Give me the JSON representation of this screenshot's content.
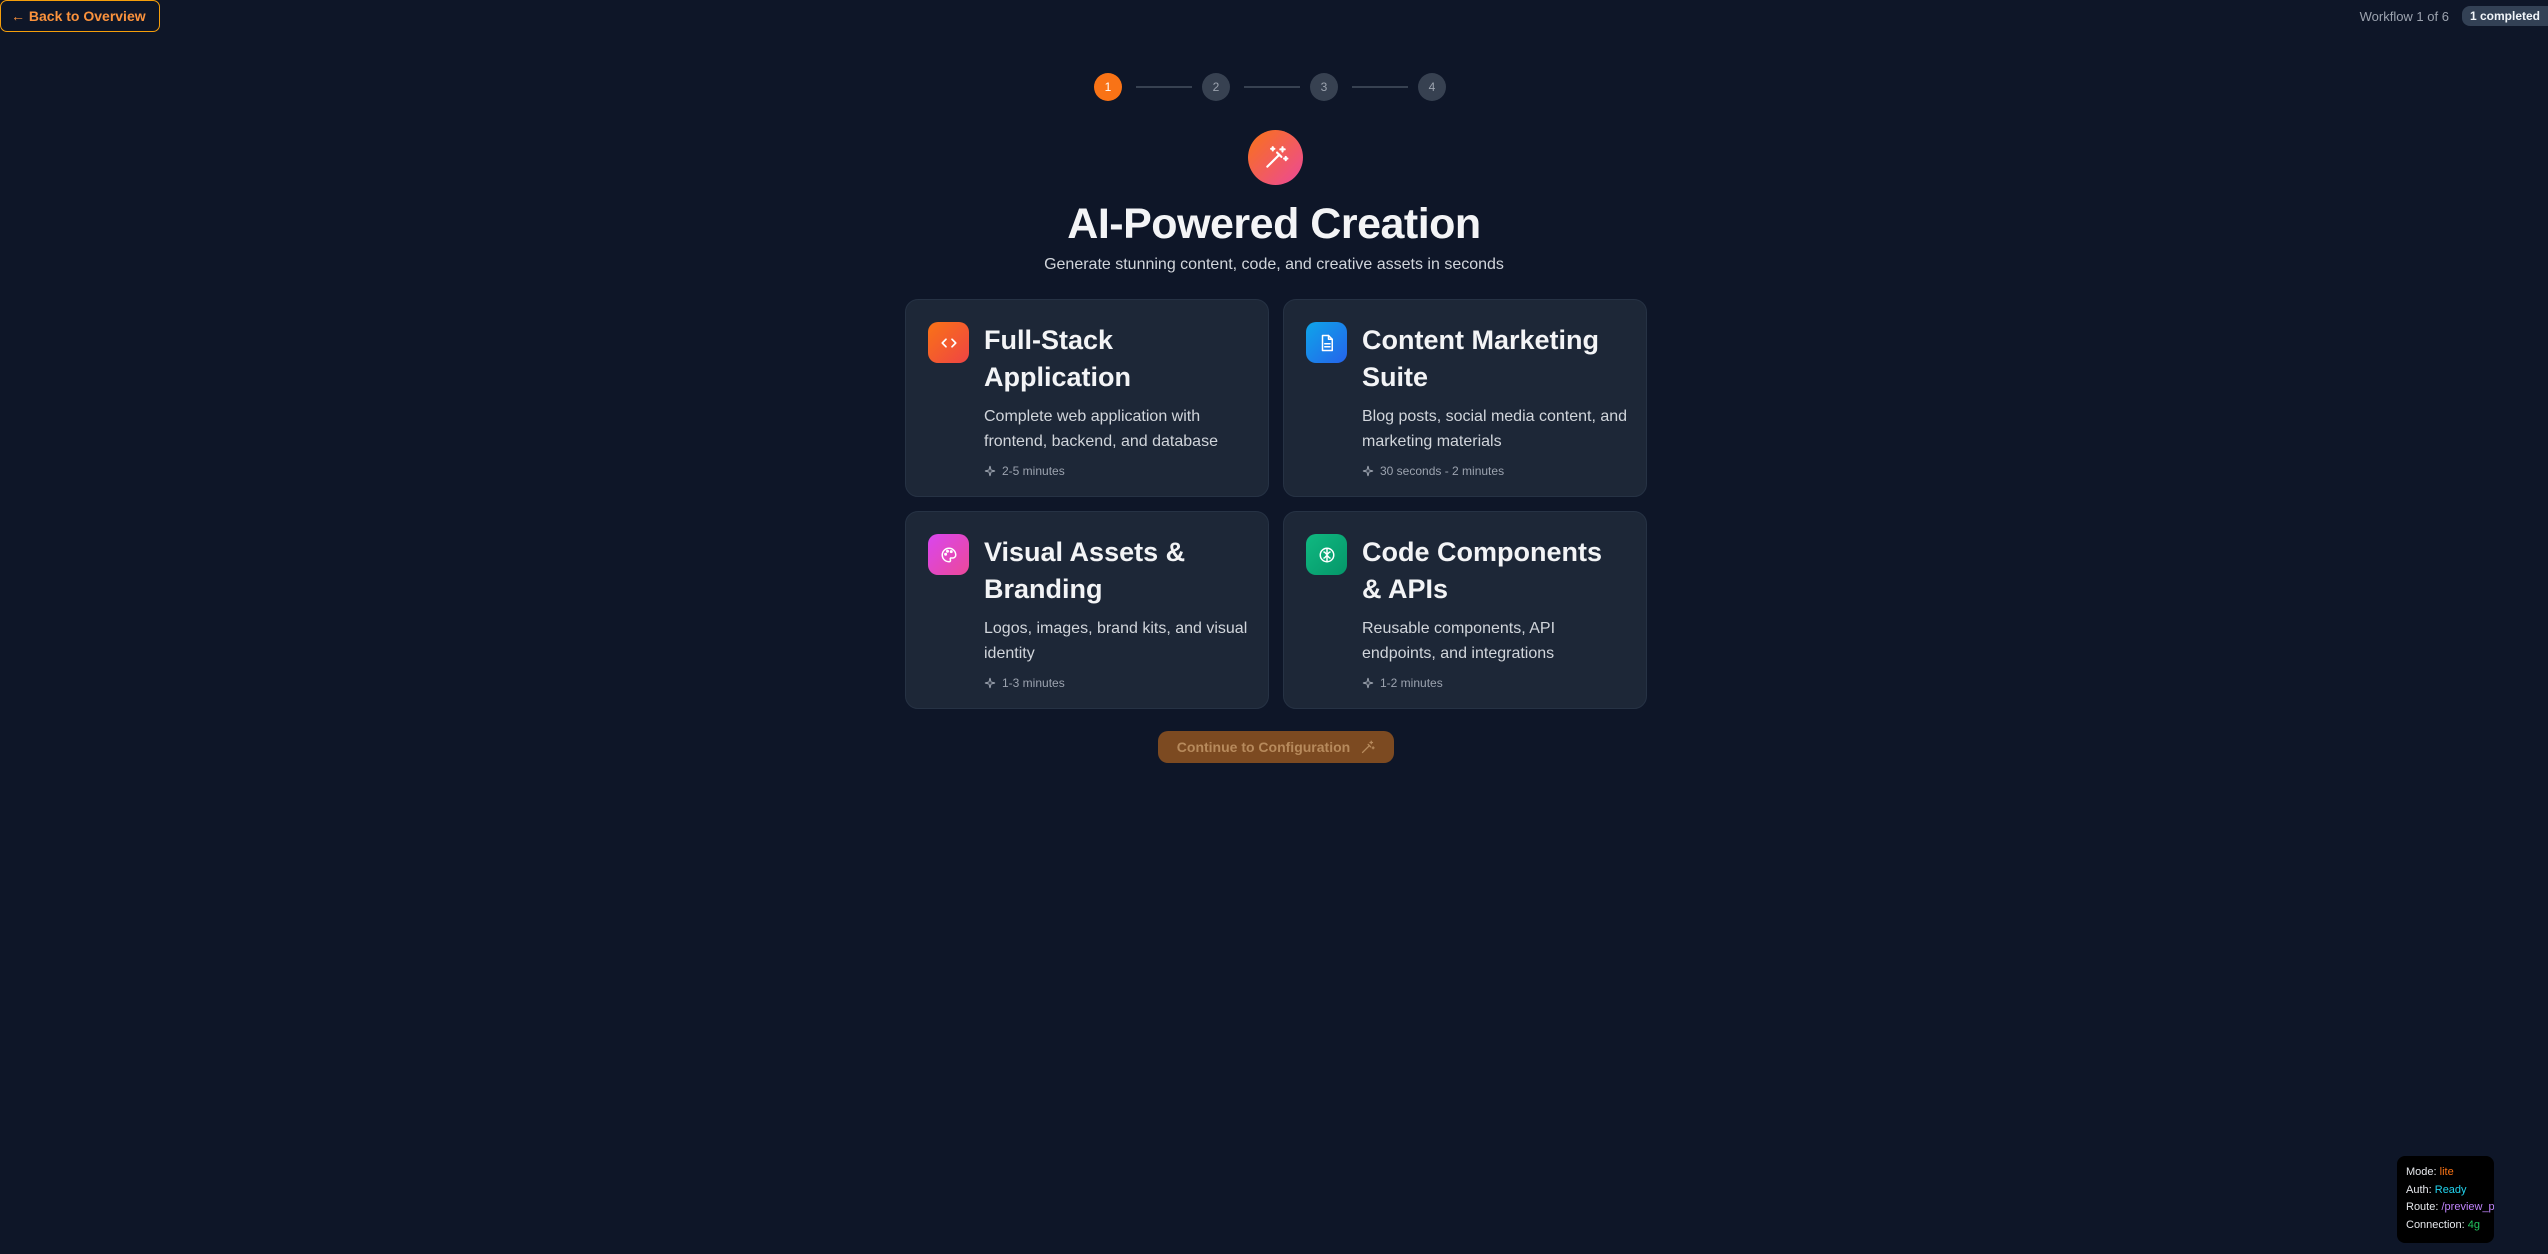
{
  "header": {
    "back_label": "← Back to Overview",
    "workflow_text": "Workflow 1 of 6",
    "completed_badge": "1 completed"
  },
  "stepper": {
    "steps": [
      "1",
      "2",
      "3",
      "4"
    ],
    "active_step": 1
  },
  "hero": {
    "icon": "magic-wand-icon",
    "title": "AI-Powered Creation",
    "subtitle": "Generate stunning content, code, and creative assets in seconds"
  },
  "cards": [
    {
      "icon": "code-icon",
      "title": "Full-Stack Application",
      "description": "Complete web application with frontend, backend, and database",
      "time": "2-5 minutes",
      "color": "#f97316"
    },
    {
      "icon": "document-icon",
      "title": "Content Marketing Suite",
      "description": "Blog posts, social media content, and marketing materials",
      "time": "30 seconds - 2 minutes",
      "color": "#0ea5e9"
    },
    {
      "icon": "palette-icon",
      "title": "Visual Assets & Branding",
      "description": "Logos, images, brand kits, and visual identity",
      "time": "1-3 minutes",
      "color": "#d946ef"
    },
    {
      "icon": "brain-icon",
      "title": "Code Components & APIs",
      "description": "Reusable components, API endpoints, and integrations",
      "time": "1-2 minutes",
      "color": "#10b981"
    }
  ],
  "continue_label": "Continue to Configuration",
  "debug": {
    "mode_label": "Mode:",
    "mode_value": "lite",
    "auth_label": "Auth:",
    "auth_value": "Ready",
    "route_label": "Route:",
    "route_value": "/preview_page.html",
    "connection_label": "Connection:",
    "connection_value": "4g"
  }
}
